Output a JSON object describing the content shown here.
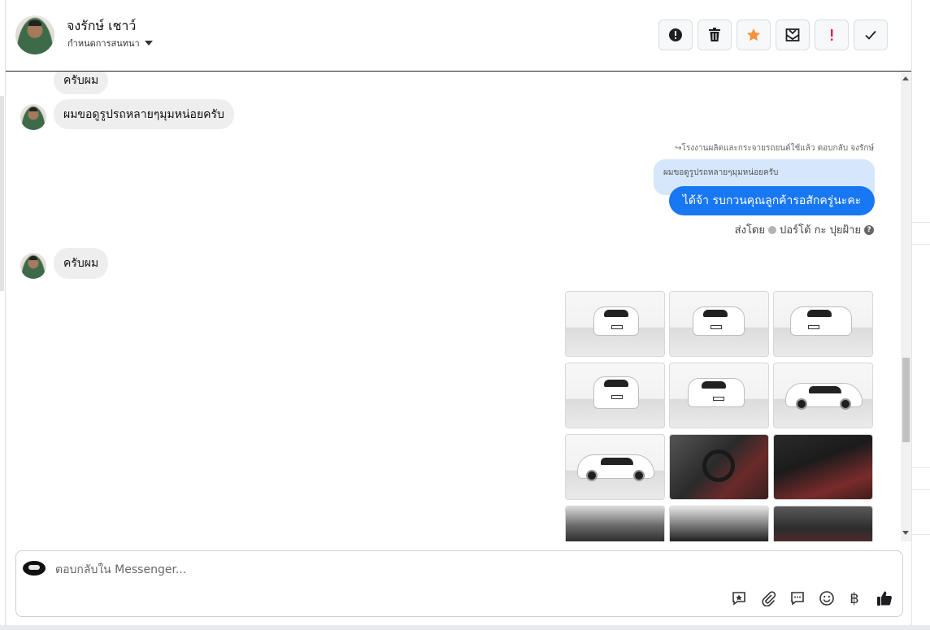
{
  "header": {
    "contact_name": "จงรักษ์ เชาว์",
    "assign_label": "กำหนดการสนทนา",
    "tools": [
      {
        "name": "mark-spam-icon"
      },
      {
        "name": "delete-icon"
      },
      {
        "name": "star-icon"
      },
      {
        "name": "mark-unread-icon"
      },
      {
        "name": "important-icon"
      },
      {
        "name": "mark-done-icon"
      }
    ]
  },
  "messages": {
    "incoming_1": "ครับผม",
    "incoming_2": "ผมขอดูรูปรถหลายๆมุมหน่อยครับ",
    "reply_meta": "↪โรงงานผลิตและกระจายรถยนต์ใช้แล้ว ตอบกลับ จงรักษ์",
    "quoted_text": "ผมขอดูรูปรถหลายๆมุมหน่อยครับ",
    "outgoing": "ได้จ้า รบกวนคุณลูกค้ารอสักครู่นะคะ",
    "sent_by_prefix": "ส่งโดย",
    "sent_by_name": "ปอร์โต้ กะ ปุยฝ้าย",
    "incoming_3": "ครับผม"
  },
  "photos": [
    {
      "kind": "front"
    },
    {
      "kind": "front"
    },
    {
      "kind": "front"
    },
    {
      "kind": "front"
    },
    {
      "kind": "front"
    },
    {
      "kind": "side"
    },
    {
      "kind": "side"
    },
    {
      "kind": "interior"
    },
    {
      "kind": "interior"
    },
    {
      "kind": "interior2"
    },
    {
      "kind": "interior2"
    },
    {
      "kind": "interior2"
    }
  ],
  "composer": {
    "placeholder": "ตอบกลับใน Messenger...",
    "currency_symbol": "฿",
    "icons": [
      "saved-reply-icon",
      "attachment-icon",
      "message-icon",
      "emoji-icon",
      "payment-icon",
      "like-icon"
    ]
  },
  "colors": {
    "accent": "#1877f2",
    "star": "#f7923a",
    "important": "#e41e3f"
  }
}
